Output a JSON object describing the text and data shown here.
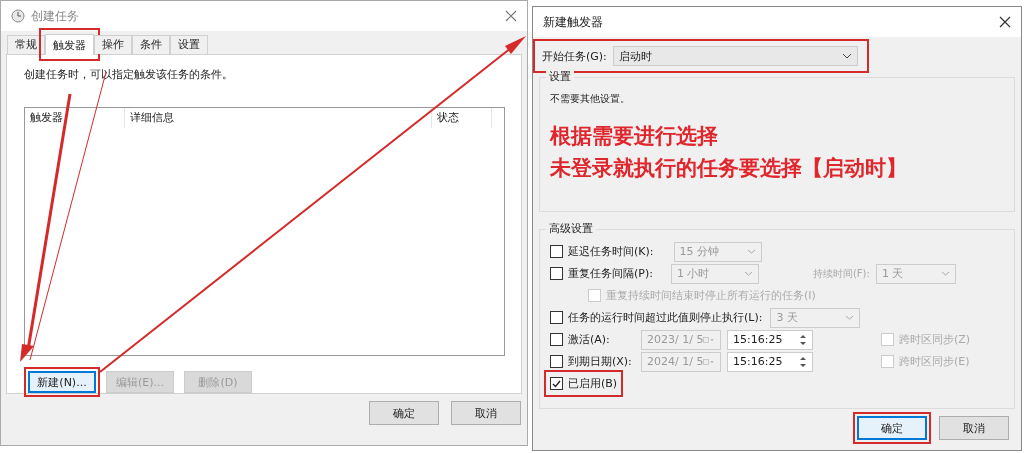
{
  "task_dialog": {
    "title": "创建任务",
    "tabs": [
      {
        "label": "常规",
        "selected": false
      },
      {
        "label": "触发器",
        "selected": true,
        "highlighted": true
      },
      {
        "label": "操作",
        "selected": false
      },
      {
        "label": "条件",
        "selected": false
      },
      {
        "label": "设置",
        "selected": false
      }
    ],
    "description": "创建任务时，可以指定触发该任务的条件。",
    "table": {
      "columns": [
        "触发器",
        "详细信息",
        "状态"
      ]
    },
    "buttons": [
      {
        "label": "新建(N)...",
        "disabled": false,
        "highlighted": true
      },
      {
        "label": "编辑(E)...",
        "disabled": true
      },
      {
        "label": "删除(D)",
        "disabled": true
      }
    ],
    "footer_buttons": [
      {
        "label": "确定"
      },
      {
        "label": "取消"
      }
    ]
  },
  "trigger_dialog": {
    "title": "新建触发器",
    "begin_task": {
      "label": "开始任务(G):",
      "value": "启动时",
      "highlighted": true
    },
    "settings": {
      "title": "设置",
      "text": "不需要其他设置。"
    },
    "annotation": [
      "根据需要进行选择",
      "未登录就执行的任务要选择【启动时】"
    ],
    "advanced": {
      "title": "高级设置",
      "options": [
        {
          "kind": "dropdown",
          "label": "延迟任务时间(K):",
          "checked": false,
          "value": "15 分钟"
        },
        {
          "kind": "repeat",
          "label": "重复任务间隔(P):",
          "checked": false,
          "value": "1 小时",
          "duration_label": "持续时间(F):",
          "duration_value": "1 天"
        },
        {
          "kind": "sub",
          "label": "重复持续时间结束时停止所有运行的任务(I)",
          "checked": false
        },
        {
          "kind": "dropdown",
          "label": "任务的运行时间超过此值则停止执行(L):",
          "checked": false,
          "value": "3 天"
        },
        {
          "kind": "datetime",
          "label": "激活(A):",
          "checked": false,
          "date": "2023/ 1/ 5",
          "time": "15:16:25",
          "sync_label": "跨时区同步(Z)",
          "sync_checked": false
        },
        {
          "kind": "datetime",
          "label": "到期日期(X):",
          "checked": false,
          "date": "2024/ 1/ 5",
          "time": "15:16:25",
          "sync_label": "跨时区同步(E)",
          "sync_checked": false
        },
        {
          "kind": "plain",
          "label": "已启用(B)",
          "checked": true,
          "highlighted": true
        }
      ]
    },
    "footer_buttons": [
      {
        "label": "确定",
        "highlighted": true
      },
      {
        "label": "取消"
      }
    ]
  }
}
